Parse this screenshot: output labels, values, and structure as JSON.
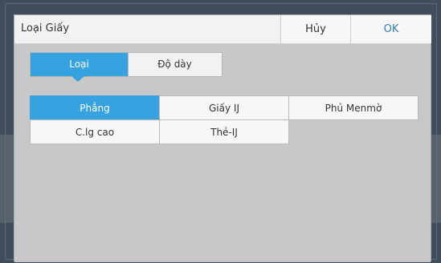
{
  "dialog": {
    "title": "Loại Giấy",
    "cancel_label": "Hủy",
    "ok_label": "OK"
  },
  "tabs": [
    {
      "label": "Loại",
      "selected": true
    },
    {
      "label": "Độ dày",
      "selected": false
    }
  ],
  "paper_types": [
    {
      "label": "Phẳng",
      "selected": true
    },
    {
      "label": "Giấy IJ",
      "selected": false
    },
    {
      "label": "Phủ Menmờ",
      "selected": false
    },
    {
      "label": "C.lg cao",
      "selected": false
    },
    {
      "label": "Thẻ-IJ",
      "selected": false
    }
  ],
  "colors": {
    "accent": "#36a3e0",
    "ok_text": "#2f7fc3",
    "panel_bg": "#c8c8c8"
  }
}
